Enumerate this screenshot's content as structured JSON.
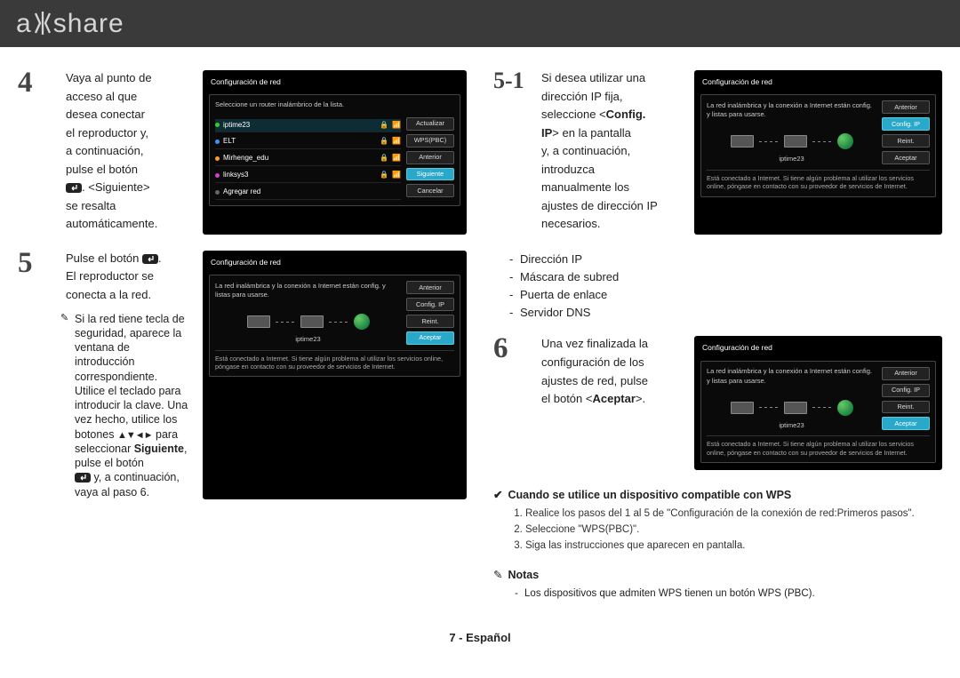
{
  "header": {
    "logo_left": "a",
    "logo_right": "share"
  },
  "left": {
    "step4": {
      "num": "4",
      "lines": [
        "Vaya al punto de",
        "acceso al que",
        "desea conectar",
        "el reproductor y,",
        "a continuación,",
        "pulse el botón"
      ],
      "line_after_icon": ". <Siguiente>",
      "tail1": "se resalta",
      "tail2": "automáticamente.",
      "ss": {
        "title": "Configuración de red",
        "sub": "Seleccione un router inalámbrico de la lista.",
        "items": [
          "iptime23",
          "ELT",
          "Mirhenge_edu",
          "linksys3",
          "Agregar red"
        ],
        "buttons": [
          "Actualizar",
          "WPS(PBC)",
          "Anterior",
          "Siguiente",
          "Cancelar"
        ],
        "hi_index": 3
      }
    },
    "step5": {
      "num": "5",
      "text_pre": "Pulse el botón ",
      "text_post": ".",
      "line2": "El reproductor se",
      "line3": "conecta a la red.",
      "note": "Si la red tiene tecla de seguridad, aparece la ventana de introducción correspondiente.",
      "note2a": "Utilice el teclado para introducir la clave. Una vez hecho, utilice los botones ",
      "note2b": " para seleccionar ",
      "note_bold": "Siguiente",
      "note2c": ", pulse el botón ",
      "note2d": " y, a continuación, vaya al paso 6.",
      "ss": {
        "title": "Configuración de red",
        "sub": "La red inalámbrica y la conexión a Internet están config. y listas para usarse.",
        "label": "iptime23",
        "buttons": [
          "Anterior",
          "Config. IP",
          "Reint.",
          "Aceptar"
        ],
        "hi_index": 3,
        "foot": "Está conectado a Internet. Si tiene algún problema al utilizar los servicios online, póngase en contacto con su proveedor de servicios de Internet."
      }
    }
  },
  "right": {
    "step51": {
      "num": "5-1",
      "lines": [
        "Si desea utilizar una",
        "dirección IP fija,",
        "seleccione <Config.",
        "IP> en la pantalla",
        "y, a continuación,",
        "introduzca",
        "manualmente los",
        "ajustes de dirección IP",
        "necesarios."
      ],
      "bold_start": 2,
      "bold_end": 3,
      "bullets": [
        "Dirección IP",
        "Máscara de subred",
        "Puerta de enlace",
        "Servidor DNS"
      ],
      "ss": {
        "title": "Configuración de red",
        "sub": "La red inalámbrica y la conexión a Internet están config. y listas para usarse.",
        "label": "iptime23",
        "buttons": [
          "Anterior",
          "Config. IP",
          "Reint.",
          "Aceptar"
        ],
        "hi_index": 1,
        "foot": "Está conectado a Internet. Si tiene algún problema al utilizar los servicios online, póngase en contacto con su proveedor de servicios de Internet."
      }
    },
    "step6": {
      "num": "6",
      "lines": [
        "Una vez finalizada la",
        "configuración de los",
        "ajustes de red, pulse",
        "el botón <Aceptar>."
      ],
      "bold_word": "Aceptar",
      "ss": {
        "title": "Configuración de red",
        "sub": "La red inalámbrica y la conexión a Internet están config. y listas para usarse.",
        "label": "iptime23",
        "buttons": [
          "Anterior",
          "Config. IP",
          "Reint.",
          "Aceptar"
        ],
        "hi_index": 3,
        "foot": "Está conectado a Internet. Si tiene algún problema al utilizar los servicios online, póngase en contacto con su proveedor de servicios de Internet."
      }
    },
    "wps": {
      "heading": "Cuando se utilice un dispositivo compatible con WPS",
      "items": [
        "Realice los pasos del 1 al 5 de \"Configuración de la conexión de red:Primeros pasos\".",
        "Seleccione \"WPS(PBC)\".",
        "Siga las instrucciones que aparecen en pantalla."
      ]
    },
    "notas": {
      "heading": "Notas",
      "items": [
        "Los dispositivos que admiten WPS tienen un botón WPS (PBC)."
      ]
    }
  },
  "footer": "7 - Español"
}
